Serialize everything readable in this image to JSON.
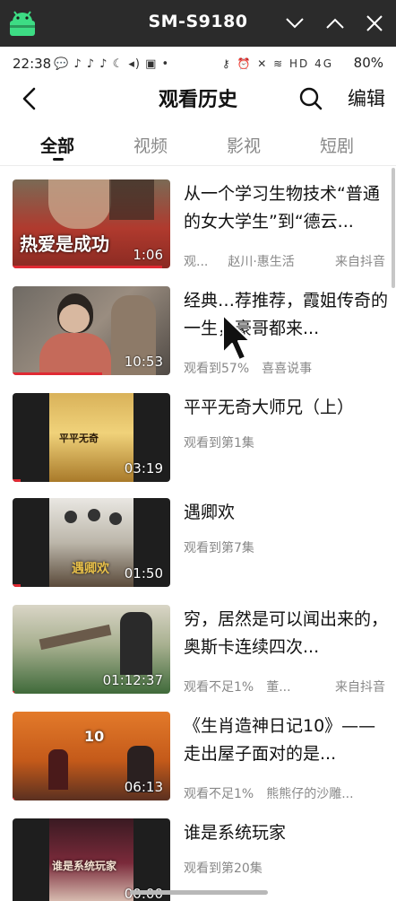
{
  "window": {
    "title": "SM-S9180"
  },
  "status_bar": {
    "time": "22:38",
    "battery": "80%",
    "notif_icons": "💬 ♪ ♪ ♪ ☾ ◂) ▣ •",
    "sys_icons": "⚷ ⏰ ✕ ≋ HD 4G",
    "network_bars": "4G"
  },
  "nav": {
    "title": "观看历史",
    "edit_label": "编辑"
  },
  "tabs": [
    {
      "label": "全部",
      "active": true
    },
    {
      "label": "视频",
      "active": false
    },
    {
      "label": "影视",
      "active": false
    },
    {
      "label": "短剧",
      "active": false
    }
  ],
  "items": [
    {
      "title": "从一个学习生物技术“普通的女大学生”到“德云...",
      "progress": "观...",
      "author": "赵川·惠生活",
      "source": "来自抖音",
      "duration": "1:06",
      "overlay_text": "热爱是成功",
      "watched_fraction": 0.95
    },
    {
      "title": "经典…荐推荐，霞姐传奇的一生，豪哥都来...",
      "progress": "观看到57%",
      "author": "喜喜说事",
      "source": "",
      "duration": "10:53",
      "overlay_text": "",
      "watched_fraction": 0.57
    },
    {
      "title": "平平无奇大师兄（上）",
      "progress": "观看到第1集",
      "author": "",
      "source": "",
      "duration": "03:19",
      "overlay_text": "平平无奇",
      "watched_fraction": 0.05
    },
    {
      "title": "遇卿欢",
      "progress": "观看到第7集",
      "author": "",
      "source": "",
      "duration": "01:50",
      "overlay_text": "遇卿欢",
      "watched_fraction": 0.05
    },
    {
      "title": "穷，居然是可以闻出来的，奥斯卡连续四次...",
      "progress": "观看不足1%",
      "author": "董...",
      "source": "来自抖音",
      "duration": "01:12:37",
      "overlay_text": "",
      "watched_fraction": 0.01
    },
    {
      "title": "《生肖造神日记10》——走出屋子面对的是...",
      "progress": "观看不足1%",
      "author": "熊熊仔的沙雕...",
      "source": "",
      "duration": "06:13",
      "overlay_text": "10",
      "watched_fraction": 0.01
    },
    {
      "title": "谁是系统玩家",
      "progress": "观看到第20集",
      "author": "",
      "source": "",
      "duration": "00:00",
      "overlay_text": "谁是系统玩家",
      "watched_fraction": 0.05
    }
  ],
  "colors": {
    "accent": "#e02a33",
    "chrome": "#2b2b2b"
  }
}
